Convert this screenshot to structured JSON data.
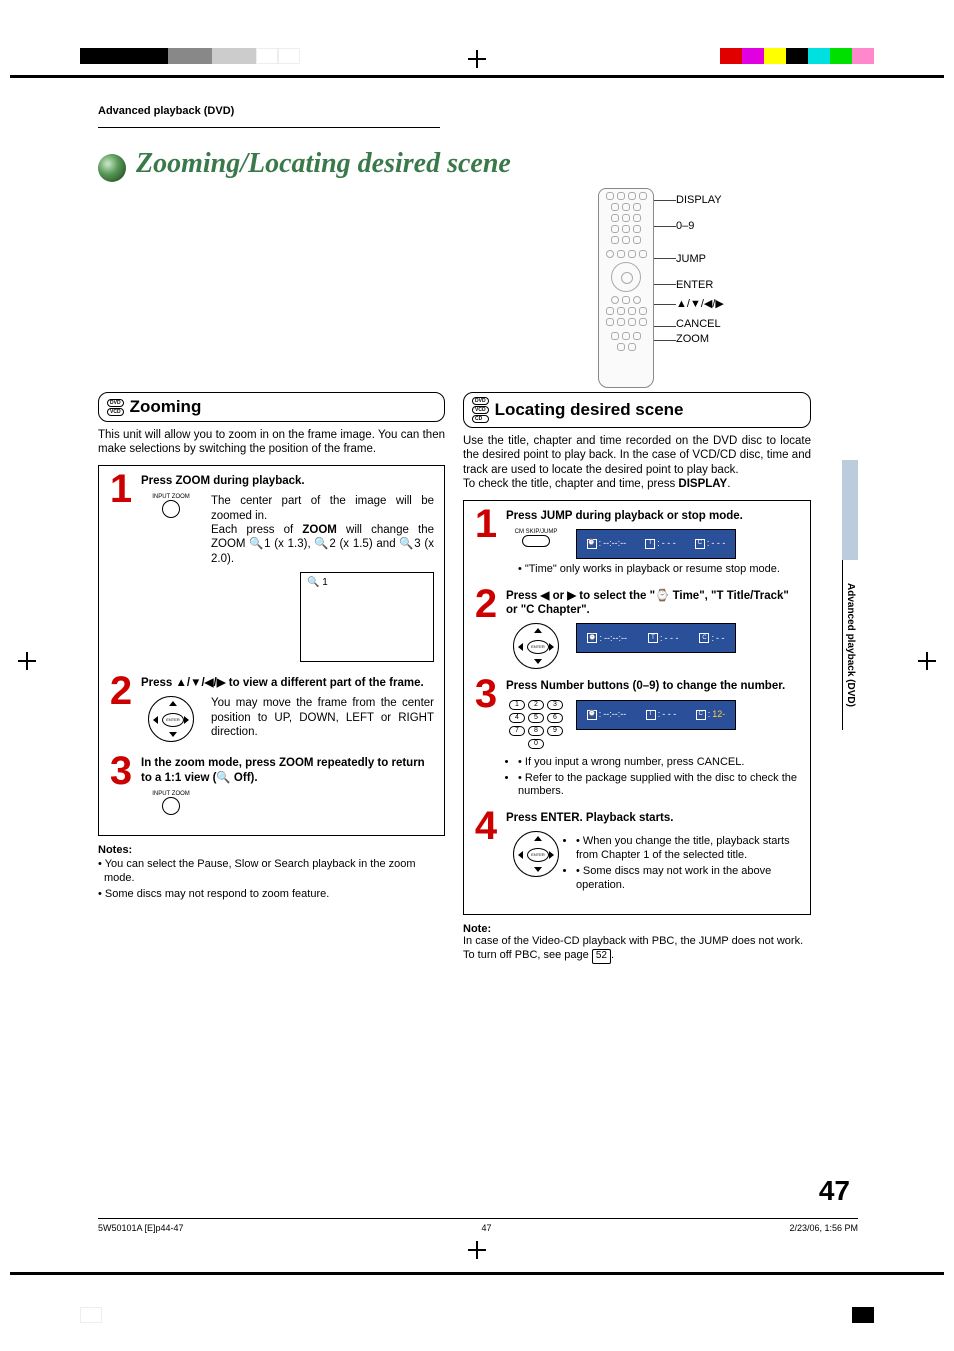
{
  "breadcrumb": "Advanced playback (DVD)",
  "page_title": "Zooming/Locating desired scene",
  "remote": {
    "labels": [
      "DISPLAY",
      "0–9",
      "JUMP",
      "ENTER",
      "▲/▼/◀/▶",
      "CANCEL",
      "ZOOM"
    ]
  },
  "zooming": {
    "title": "Zooming",
    "badges": [
      "DVD",
      "VCD"
    ],
    "intro": "This unit will allow you to zoom in on the frame image. You can then make selections by switching the position of the frame.",
    "steps": [
      {
        "label": "Press ZOOM during playback.",
        "btn_label": "INPUT ZOOM",
        "text_1": "The center part of the image will be zoomed in.",
        "text_2a": "Each press of ",
        "text_2b": "ZOOM",
        "text_2c": " will change the ZOOM 🔍1 (x 1.3), 🔍2 (x 1.5) and 🔍3 (x 2.0).",
        "screen": "🔍 1"
      },
      {
        "label_a": "Press ",
        "label_b": "▲/▼/◀/▶",
        "label_c": " to view a different part of the frame.",
        "text": "You may move the frame from the center position to UP, DOWN, LEFT or RIGHT direction."
      },
      {
        "label": "In the zoom mode, press ZOOM repeatedly to return to a 1:1 view (🔍 Off).",
        "btn_label": "INPUT ZOOM"
      }
    ],
    "notes_title": "Notes:",
    "notes": [
      "• You can select the Pause, Slow or Search playback in the zoom mode.",
      "• Some discs may not respond to zoom feature."
    ]
  },
  "locating": {
    "title": "Locating desired scene",
    "badges": [
      "DVD",
      "VCD",
      "CD"
    ],
    "intro_a": "Use the title, chapter and time recorded on the DVD disc to locate the desired point to play back. In the case of VCD/CD disc, time and track are used to locate the desired point to play back.",
    "intro_b_a": "To check the title, chapter and time, press ",
    "intro_b_b": "DISPLAY",
    "intro_b_c": ".",
    "steps": [
      {
        "label": "Press JUMP during playback or stop mode.",
        "btn_label": "CM SKIP/JUMP",
        "osd": {
          "time": "--:--:--",
          "t": "- - -",
          "c": "- - -"
        },
        "note": "• \"Time\" only works in playback or resume stop mode."
      },
      {
        "label_a": "Press ",
        "label_arrows": "◀ or ▶",
        "label_b": " to select the \"⌚ Time\", \"T Title/Track\" or \"C Chapter\".",
        "osd": {
          "time": "--:--:--",
          "t": "- - -",
          "c": "- -"
        }
      },
      {
        "label": "Press Number buttons (0–9) to change the number.",
        "osd": {
          "time": "--:--:--",
          "t": "- - -",
          "c": "12-"
        },
        "bullets": [
          "If you input a wrong number, press CANCEL.",
          "Refer to the package supplied with the disc to check the numbers."
        ]
      },
      {
        "label": "Press ENTER. Playback starts.",
        "bullets": [
          "When you change the title, playback starts from Chapter 1 of the selected title.",
          "Some discs may not work in the above operation."
        ]
      }
    ],
    "note_title": "Note:",
    "note_a": "In case of the Video-CD playback with PBC, the JUMP does not work. To turn off PBC, see page ",
    "note_page": "52",
    "note_b": "."
  },
  "side_tab": "Advanced playback (DVD)",
  "page_number": "47",
  "footer": {
    "left": "5W50101A [E]p44-47",
    "center": "47",
    "right": "2/23/06, 1:56 PM"
  }
}
